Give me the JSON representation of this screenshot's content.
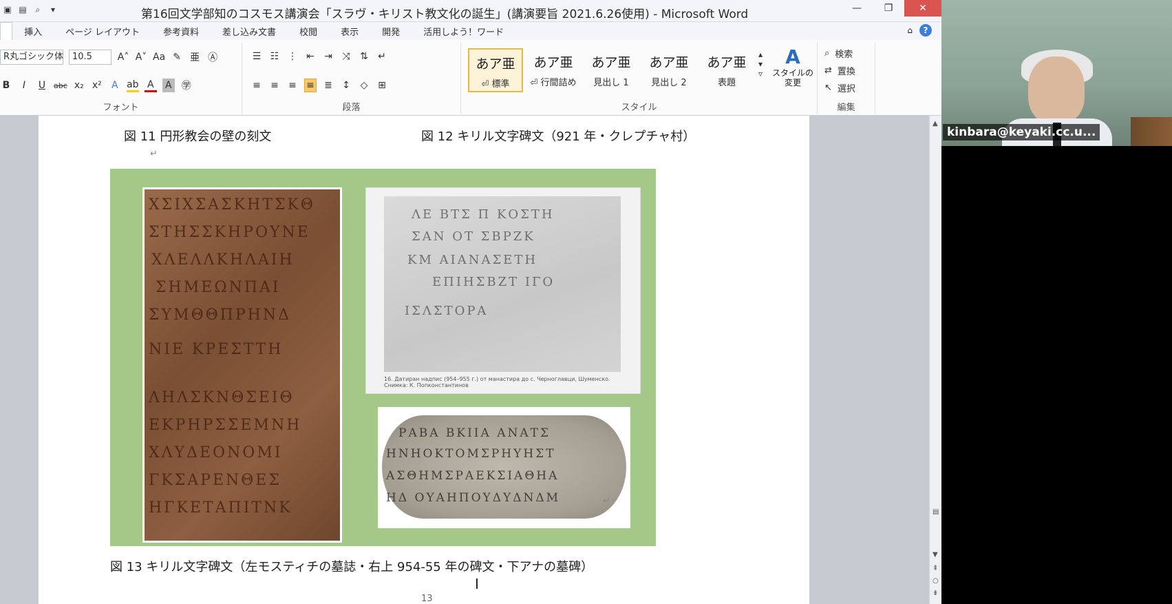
{
  "window": {
    "title": "第16回文学部知のコスモス講演会「スラヴ・キリスト教文化の誕生」(講演要旨  2021.6.26使用) - Microsoft Word"
  },
  "tabs": [
    "挿入",
    "ページ レイアウト",
    "参考資料",
    "差し込み文書",
    "校閲",
    "表示",
    "開発",
    "活用しよう！ワード"
  ],
  "ribbon": {
    "font_name": "R丸ゴシック体",
    "font_size": "10.5",
    "font_label": "フォント",
    "paragraph_label": "段落",
    "styles_label": "スタイル",
    "edit_label": "編集",
    "styles": [
      {
        "sample": "あア亜",
        "label": "⏎ 標準"
      },
      {
        "sample": "あア亜",
        "label": "⏎ 行間詰め"
      },
      {
        "sample": "あア亜",
        "label": "見出し 1"
      },
      {
        "sample": "あア亜",
        "label": "見出し 2"
      },
      {
        "sample": "あア亜",
        "label": "表題"
      }
    ],
    "change_styles": "スタイルの\n変更",
    "edit_items": [
      "検索",
      "置換",
      "選択"
    ]
  },
  "document": {
    "caption_fig11": "図 11  円形教会の壁の刻文",
    "caption_fig12": "図 12 キリル文字碑文（921 年・クレプチャ村）",
    "caption_fig13": "図 13  キリル文字碑文（左モスティチの墓誌・右上 954-55 年の碑文・下アナの墓碑）",
    "page_number": "13",
    "photo_caption": "16. Датиран надпис (954–955 г.) от манастира до с. Черноглавци, Шуменско. Снимка: К. Попконстантинов"
  },
  "webcam": {
    "name": "kinbara@keyaki.cc.u..."
  }
}
